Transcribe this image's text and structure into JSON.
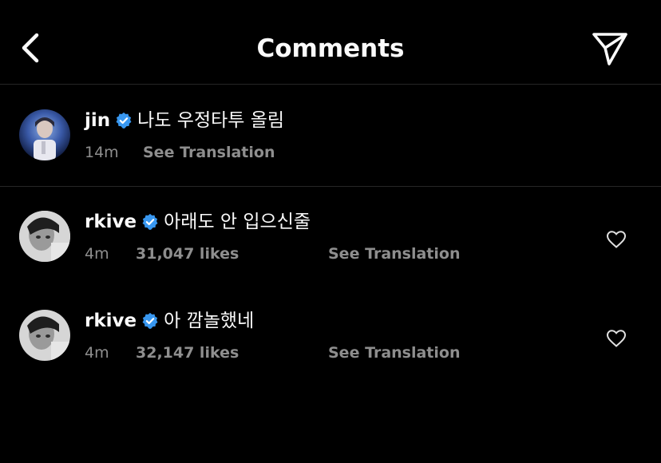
{
  "header": {
    "title": "Comments",
    "back_icon": "chevron-left-icon",
    "share_icon": "paper-plane-icon"
  },
  "caption": {
    "username": "jin",
    "verified": true,
    "text": "나도 우정타투 올림",
    "time": "14m",
    "see_translation": "See Translation"
  },
  "comments": [
    {
      "username": "rkive",
      "verified": true,
      "text": "아래도 안 입으신줄",
      "time": "4m",
      "likes": "31,047 likes",
      "see_translation": "See Translation"
    },
    {
      "username": "rkive",
      "verified": true,
      "text": "아 깜놀했네",
      "time": "4m",
      "likes": "32,147 likes",
      "see_translation": "See Translation"
    }
  ],
  "colors": {
    "background": "#000000",
    "text": "#fafafa",
    "secondary_text": "#8e8e8e",
    "verified_badge": "#3897f0",
    "divider": "#262626"
  }
}
